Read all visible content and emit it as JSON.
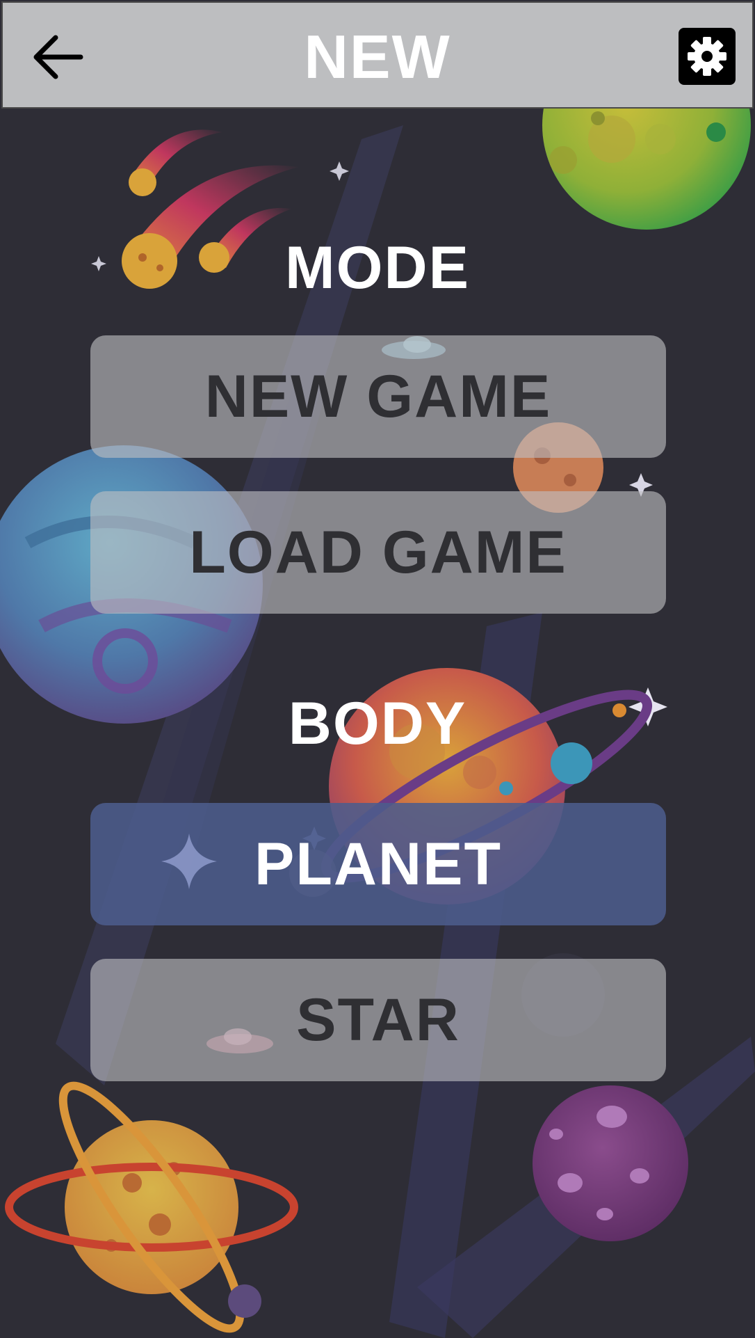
{
  "header": {
    "title": "NEW",
    "back_icon": "arrow-left-icon",
    "settings_icon": "gear-icon"
  },
  "mode": {
    "label": "MODE",
    "buttons": [
      "NEW GAME",
      "LOAD GAME"
    ]
  },
  "body_section": {
    "label": "BODY",
    "buttons": [
      "PLANET",
      "STAR"
    ],
    "selected": "PLANET"
  },
  "colors": {
    "background": "#2e2d36",
    "header_bar": "#bdbec0",
    "button": "#bebfc1",
    "button_selected": "#4c5c8c",
    "button_text": "#2f2f33"
  }
}
